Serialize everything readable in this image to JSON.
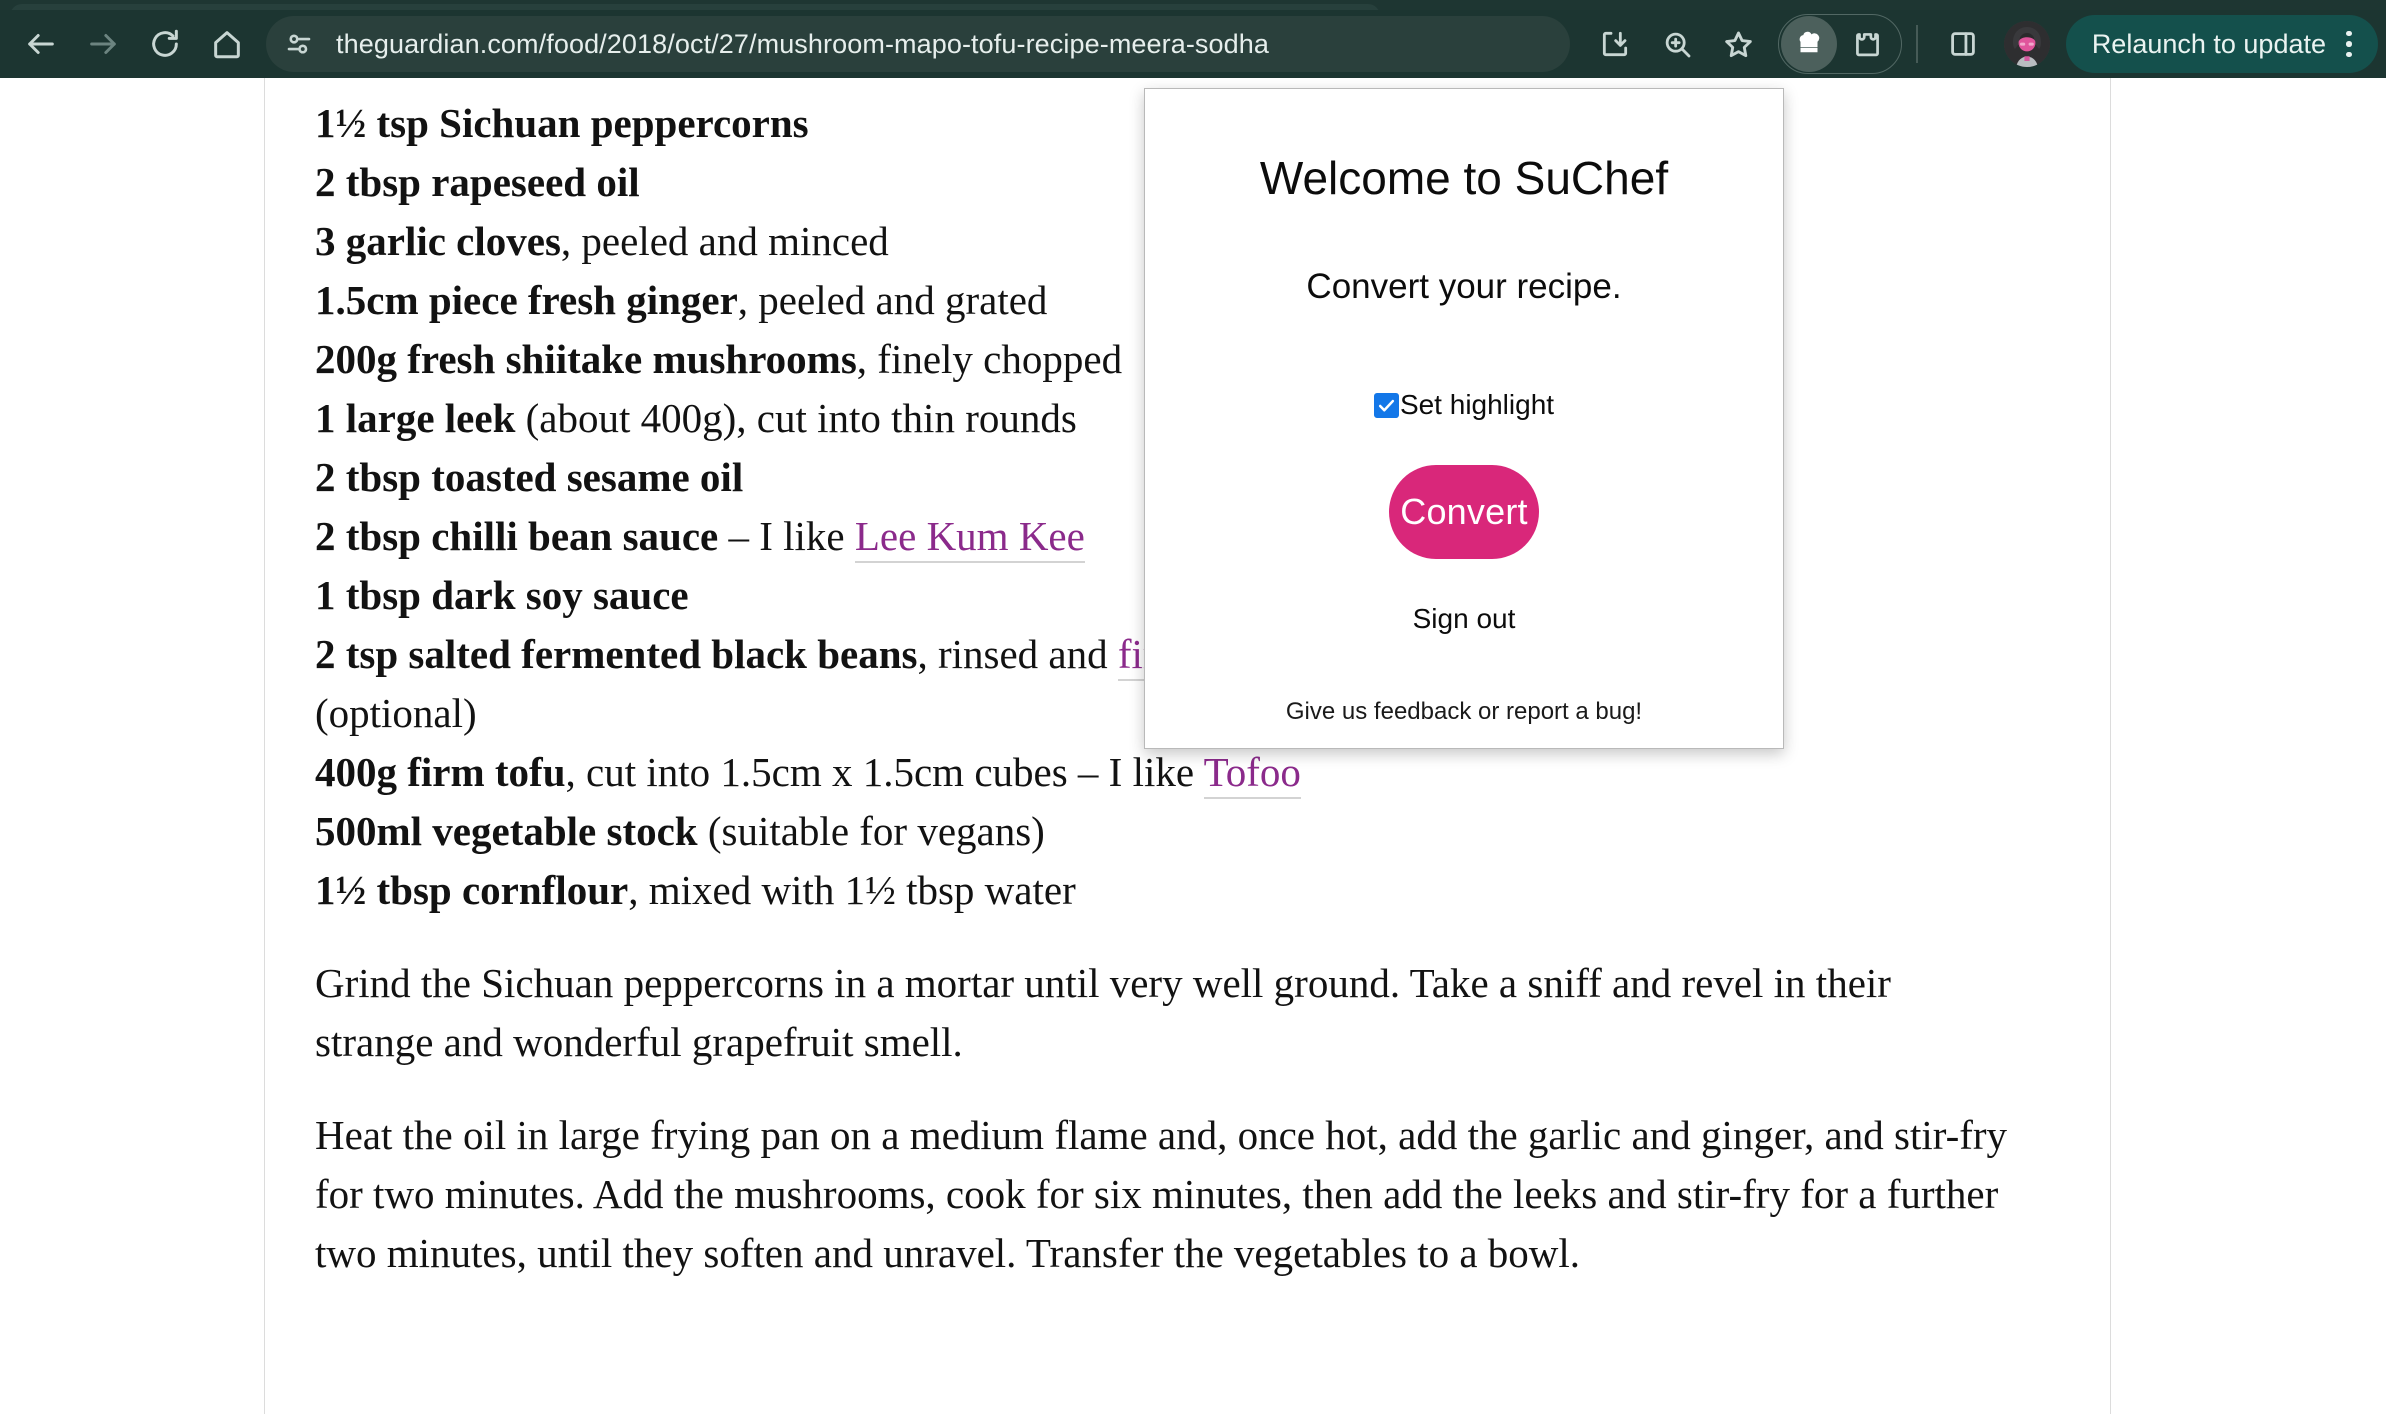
{
  "browser": {
    "url": "theguardian.com/food/2018/oct/27/mushroom-mapo-tofu-recipe-meera-sodha",
    "nav": {
      "back": "Back",
      "forward": "Forward",
      "reload": "Reload",
      "home": "Home"
    },
    "toolbar_icons": [
      "back-arrow-icon",
      "forward-arrow-icon",
      "reload-icon",
      "home-icon",
      "site-settings-icon",
      "install-app-icon",
      "zoom-icon",
      "bookmark-star-icon",
      "chef-hat-extension-icon",
      "extensions-puzzle-icon",
      "side-panel-icon",
      "profile-avatar-icon"
    ],
    "relaunch_label": "Relaunch to update",
    "menu_label": "Chrome menu",
    "colors": {
      "toolbar_bg": "#1c3531",
      "omnibox_bg": "#2a403c",
      "relaunch_bg": "#14504c",
      "toolbar_text": "#e6eeec"
    }
  },
  "article": {
    "ingredients": [
      {
        "qty": "1½ tsp Sichuan peppercorns",
        "rest": ""
      },
      {
        "qty": "2 tbsp rapeseed oil",
        "rest": ""
      },
      {
        "qty": "3 garlic cloves",
        "rest": ", peeled and minced"
      },
      {
        "qty": "1.5cm piece fresh ginger",
        "rest": ", peeled and grated"
      },
      {
        "qty": "200g fresh shiitake mushrooms",
        "rest": ", finely chopped"
      },
      {
        "qty": "1 large leek",
        "rest": " (about 400g), cut into thin rounds"
      },
      {
        "qty": "2 tbsp toasted sesame oil",
        "rest": ""
      },
      {
        "qty": "2 tbsp chilli bean sauce",
        "rest": " – I like ",
        "link": "Lee Kum Kee",
        "tail": ""
      },
      {
        "qty": "1 tbsp dark soy sauce",
        "rest": ""
      },
      {
        "qty": "2 tsp salted fermented black beans",
        "rest": ", rinsed and ",
        "link": "finely ground",
        "tail": ""
      },
      {
        "qty": "",
        "rest": "(optional)"
      },
      {
        "qty": "400g firm tofu",
        "rest": ", cut into 1.5cm x 1.5cm cubes – I like ",
        "link": "Tofoo",
        "tail": ""
      },
      {
        "qty": "500ml vegetable stock",
        "rest": " (suitable for vegans)"
      },
      {
        "qty": "1½ tbsp cornflour",
        "rest": ", mixed with 1½ tbsp water"
      }
    ],
    "paragraphs": [
      "Grind the Sichuan peppercorns in a mortar until very well ground. Take a sniff and revel in their strange and wonderful grapefruit smell.",
      "Heat the oil in large frying pan on a medium flame and, once hot, add the garlic and ginger, and stir-fry for two minutes. Add the mushrooms, cook for six minutes, then add the leeks and stir-fry for a further two minutes, until they soften and unravel. Transfer the vegetables to a bowl."
    ],
    "link_color": "#8b2a8b"
  },
  "popup": {
    "title": "Welcome to SuChef",
    "subtitle": "Convert your recipe.",
    "checkbox_label": "Set highlight",
    "checkbox_checked": true,
    "convert_label": "Convert",
    "signout_label": "Sign out",
    "feedback_label": "Give us feedback or report a bug!",
    "accent_color": "#d9277a",
    "checkbox_color": "#1377e8"
  }
}
